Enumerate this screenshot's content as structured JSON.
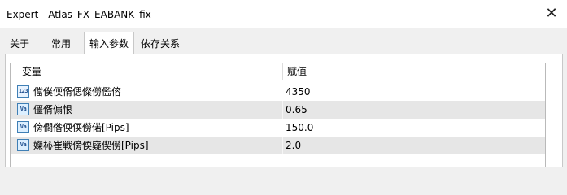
{
  "window": {
    "title": "Expert - Atlas_FX_EABANK_fix",
    "close_glyph": "✕"
  },
  "tabs": [
    {
      "label": "关于",
      "active": false
    },
    {
      "label": "常用",
      "active": false
    },
    {
      "label": "输入参数",
      "active": true
    },
    {
      "label": "依存关系",
      "active": false
    }
  ],
  "table": {
    "columns": [
      "变量",
      "赋值"
    ],
    "rows": [
      {
        "icon": "numeric-param-icon",
        "icon_text": "123",
        "name": "儅僕偄偦偲儏僗儖傛",
        "value": "4350"
      },
      {
        "icon": "value-param-icon",
        "icon_text": "Va",
        "name": "僵偦傓恨",
        "value": "0.65"
      },
      {
        "icon": "value-param-icon",
        "icon_text": "Va",
        "name": "傍僴偺偄偄僗偌[Pips]",
        "value": "150.0"
      },
      {
        "icon": "value-param-icon",
        "icon_text": "Va",
        "name": "嬫杺崔戦傍偄嶷偰僗[Pips]",
        "value": "2.0"
      }
    ]
  }
}
